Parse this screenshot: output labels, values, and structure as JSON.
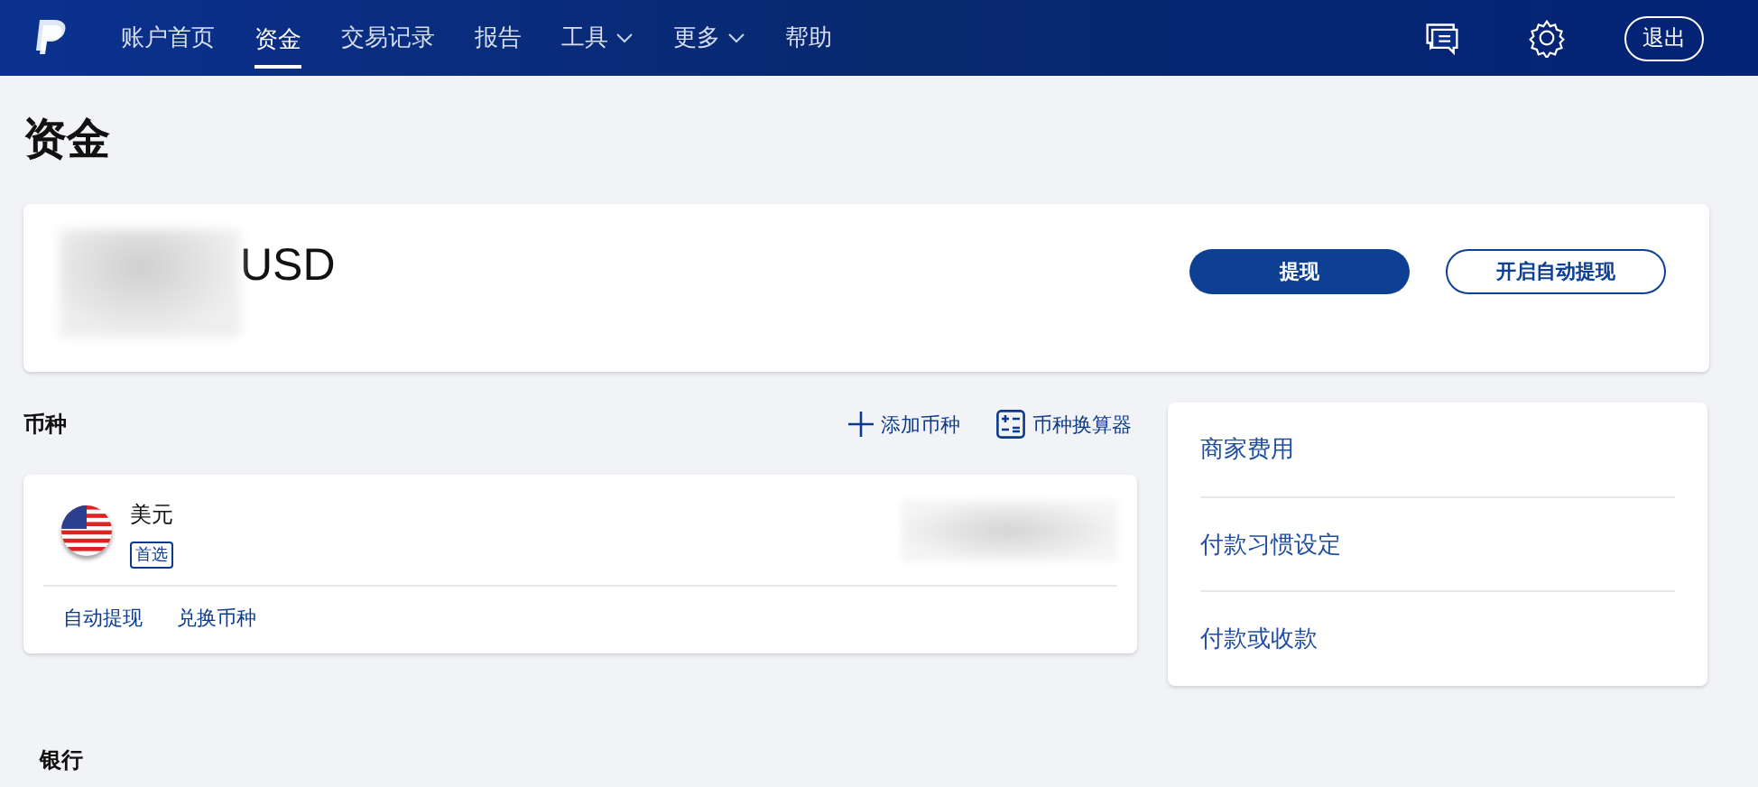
{
  "nav": {
    "items": [
      {
        "label": "账户首页",
        "selected": false,
        "dropdown": false
      },
      {
        "label": "资金",
        "selected": true,
        "dropdown": false
      },
      {
        "label": "交易记录",
        "selected": false,
        "dropdown": false
      },
      {
        "label": "报告",
        "selected": false,
        "dropdown": false
      },
      {
        "label": "工具",
        "selected": false,
        "dropdown": true
      },
      {
        "label": "更多",
        "selected": false,
        "dropdown": true
      },
      {
        "label": "帮助",
        "selected": false,
        "dropdown": false
      }
    ],
    "logout": "退出"
  },
  "page_title": "资金",
  "balance": {
    "currency": "USD",
    "buttons": [
      {
        "label": "提现",
        "kind": "primary"
      },
      {
        "label": "开启自动提现",
        "kind": "secondary"
      }
    ]
  },
  "currencies": {
    "title": "币种",
    "actions": [
      {
        "label": "添加币种",
        "kind": "add"
      },
      {
        "label": "币种换算器",
        "kind": "calculator"
      }
    ],
    "items": [
      {
        "name": "美元",
        "badge": "首选",
        "links": [
          "自动提现",
          "兑换币种"
        ]
      }
    ]
  },
  "side_links": [
    "商家费用",
    "付款习惯设定",
    "付款或收款"
  ],
  "bank": {
    "title": "银行"
  }
}
